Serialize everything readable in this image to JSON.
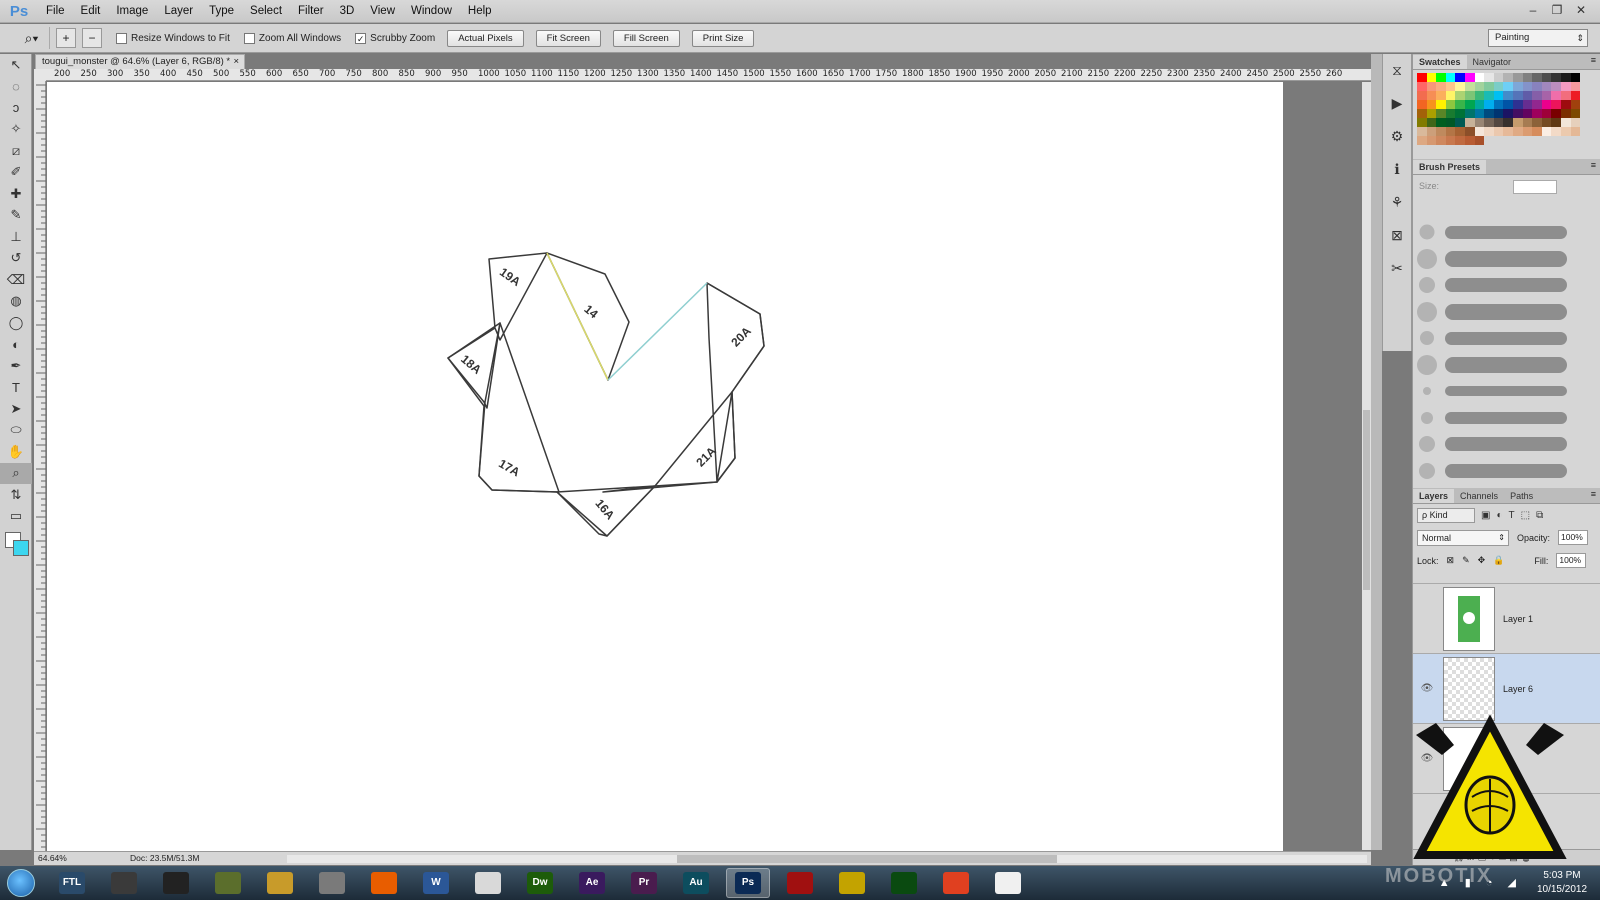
{
  "app": {
    "logo": "Ps"
  },
  "menu": [
    "File",
    "Edit",
    "Image",
    "Layer",
    "Type",
    "Select",
    "Filter",
    "3D",
    "View",
    "Window",
    "Help"
  ],
  "window_controls": [
    "–",
    "❐",
    "✕"
  ],
  "options": {
    "tool_icon": "zoom-tool-icon",
    "zoom_in": "+",
    "zoom_out": "−",
    "resize_windows": "Resize Windows to Fit",
    "zoom_all": "Zoom All Windows",
    "scrubby": "Scrubby Zoom",
    "scrubby_checked": "✓",
    "actual_pixels": "Actual Pixels",
    "fit_screen": "Fit Screen",
    "fill_screen": "Fill Screen",
    "print_size": "Print Size",
    "workspace": "Painting"
  },
  "document": {
    "tab_title": "tougui_monster @ 64.6% (Layer 6, RGB/8) *",
    "close": "×"
  },
  "ruler_labels": [
    "200",
    "250",
    "300",
    "350",
    "400",
    "450",
    "500",
    "550",
    "600",
    "650",
    "700",
    "750",
    "800",
    "850",
    "900",
    "950",
    "1000",
    "1050",
    "1100",
    "1150",
    "1200",
    "1250",
    "1300",
    "1350",
    "1400",
    "1450",
    "1500",
    "1550",
    "1600",
    "1650",
    "1700",
    "1750",
    "1800",
    "1850",
    "1900",
    "1950",
    "2000",
    "2050",
    "2100",
    "2150",
    "2200",
    "2250",
    "2300",
    "2350",
    "2400",
    "2450",
    "2500",
    "2550",
    "260"
  ],
  "tools": [
    "↖",
    "◌",
    "ↄ",
    "✧",
    "⧄",
    "✐",
    "✚",
    "✎",
    "⊥",
    "↺",
    "⌫",
    "◍",
    "◯",
    "◐",
    "✒",
    "T",
    "➤",
    "⬭",
    "✋",
    "⌕",
    "⇅",
    "▭",
    "▢"
  ],
  "drawing_labels": {
    "p19": "19A",
    "p14": "14",
    "p20": "20A",
    "p18": "18A",
    "p17": "17A",
    "p21": "21A",
    "p16": "16A"
  },
  "status": {
    "zoom": "64.64%",
    "doc": "Doc: 23.5M/51.3M"
  },
  "panels": {
    "swatches_tab": "Swatches",
    "navigator_tab": "Navigator",
    "brush_presets_tab": "Brush Presets",
    "size_label": "Size:",
    "layers_tab": "Layers",
    "channels_tab": "Channels",
    "paths_tab": "Paths",
    "kind": "ρ Kind",
    "blend_mode": "Normal",
    "opacity_label": "Opacity:",
    "opacity": "100%",
    "lock_label": "Lock:",
    "fill_label": "Fill:",
    "fill": "100%",
    "layers": [
      {
        "name": "Layer 1",
        "visible": false
      },
      {
        "name": "Layer 6",
        "visible": true
      },
      {
        "name": "",
        "visible": true
      }
    ],
    "footer_icons": "⛓ fx ◻ ◐ ▭ ▤ 🗑"
  },
  "colors": {
    "foreground": "#ffffff",
    "background": "#3cd6ef",
    "yellow_line": "#d9d96a",
    "teal_line": "#8fcfd0"
  },
  "taskbar": {
    "apps": [
      "FTL",
      "",
      "",
      "",
      "",
      "",
      "",
      "W",
      "",
      "Dw",
      "Ae",
      "Pr",
      "Au",
      "Ps",
      "",
      "",
      "",
      "",
      ""
    ],
    "active": "Ps",
    "time": "5:03 PM",
    "date": "10/15/2012"
  },
  "watermark": "MOBOTIX"
}
